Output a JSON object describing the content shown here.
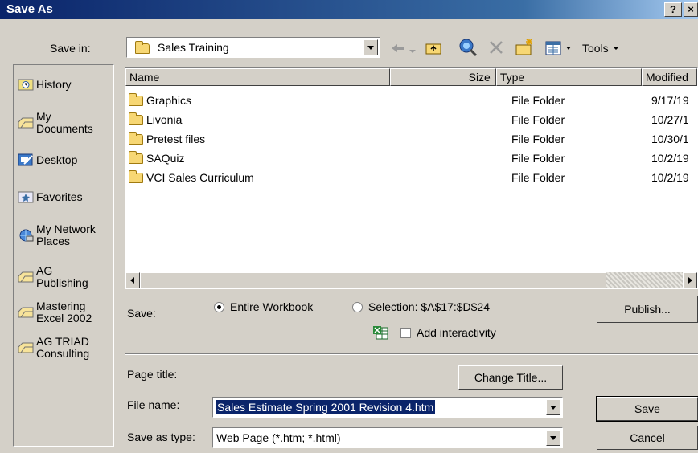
{
  "window": {
    "title": "Save As",
    "help_label": "?",
    "close_label": "×"
  },
  "savein": {
    "label": "Save in:",
    "value": "Sales Training"
  },
  "toolbar": {
    "tools_label": "Tools"
  },
  "places": [
    {
      "label": "History",
      "icon": "history-icon"
    },
    {
      "label": "My Documents",
      "icon": "my-documents-icon"
    },
    {
      "label": "Desktop",
      "icon": "desktop-icon"
    },
    {
      "label": "Favorites",
      "icon": "favorites-icon"
    },
    {
      "label": "My Network Places",
      "icon": "network-places-icon"
    },
    {
      "label": "AG Publishing",
      "icon": "folder-shortcut-icon"
    },
    {
      "label": "Mastering Excel 2002",
      "icon": "folder-shortcut-icon"
    },
    {
      "label": "AG TRIAD Consulting",
      "icon": "folder-shortcut-icon"
    }
  ],
  "files": {
    "columns": [
      "Name",
      "Size",
      "Type",
      "Modified"
    ],
    "rows": [
      {
        "name": "Graphics",
        "type": "File Folder",
        "modified": "9/17/19"
      },
      {
        "name": "Livonia",
        "type": "File Folder",
        "modified": "10/27/1"
      },
      {
        "name": "Pretest files",
        "type": "File Folder",
        "modified": "10/30/1"
      },
      {
        "name": "SAQuiz",
        "type": "File Folder",
        "modified": "10/2/19"
      },
      {
        "name": "VCI Sales Curriculum",
        "type": "File Folder",
        "modified": "10/2/19"
      }
    ]
  },
  "save_options": {
    "label": "Save:",
    "entire_workbook": "Entire Workbook",
    "selection": "Selection: $A$17:$D$24",
    "add_interactivity": "Add interactivity",
    "publish_label": "Publish..."
  },
  "page_title": {
    "label": "Page title:",
    "change_label": "Change Title..."
  },
  "filename": {
    "label": "File name:",
    "value": "Sales Estimate Spring 2001 Revision 4.htm"
  },
  "savetype": {
    "label": "Save as type:",
    "value": "Web Page (*.htm; *.html)"
  },
  "buttons": {
    "save": "Save",
    "cancel": "Cancel"
  }
}
